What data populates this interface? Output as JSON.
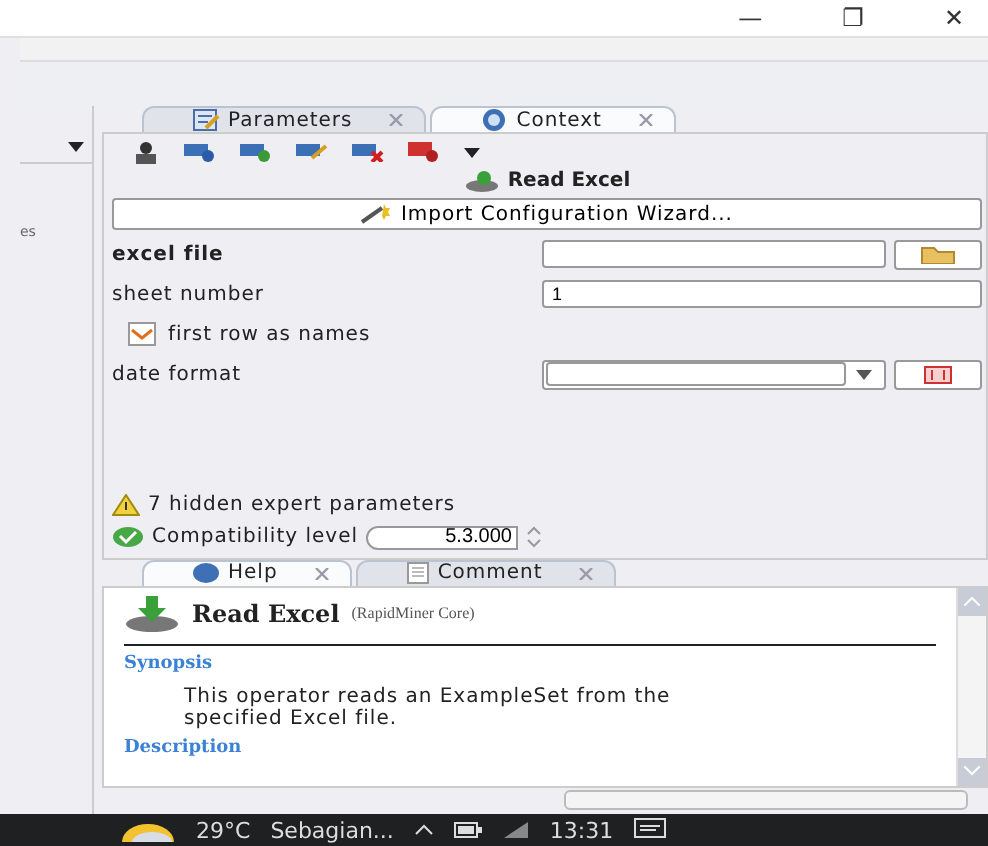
{
  "window": {
    "controls": [
      "—",
      "❐",
      "✕"
    ]
  },
  "left_panel": {
    "cut_text": "es"
  },
  "tabs": [
    {
      "label": "Parameters",
      "selected": false,
      "kind": "params"
    },
    {
      "label": "Context",
      "selected": true,
      "kind": "context"
    }
  ],
  "operator": {
    "title": "Read Excel"
  },
  "wizard_button": "Import Configuration Wizard...",
  "parameters": [
    {
      "kind": "file",
      "label": "excel file",
      "bold": true
    },
    {
      "kind": "text",
      "label": "sheet number",
      "bold": false,
      "value": "1"
    },
    {
      "kind": "checkbox",
      "label": "first row as names",
      "checked": true
    },
    {
      "kind": "combo",
      "label": "date format",
      "bold": false
    }
  ],
  "hidden_params": "7 hidden expert parameters",
  "compatibility": {
    "label": "Compatibility level",
    "value": "5.3.000"
  },
  "help_tabs": [
    {
      "label": "Help",
      "selected": true,
      "kind": "help"
    },
    {
      "label": "Comment",
      "selected": false,
      "kind": "comment"
    }
  ],
  "help": {
    "title": "Read Excel",
    "subtitle": "(RapidMiner Core)",
    "synopsis_heading": "Synopsis",
    "synopsis": "This operator reads an ExampleSet from the specified Excel file.",
    "description_heading": "Description"
  },
  "taskbar": {
    "temperature": "29°C",
    "weather": "Sebagian...",
    "time": "13:31"
  }
}
